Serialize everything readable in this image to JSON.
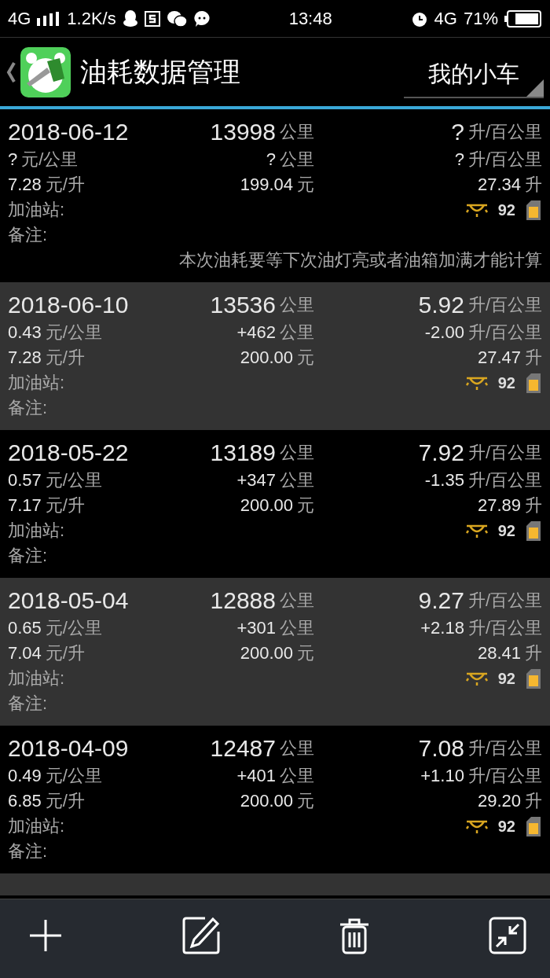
{
  "status_bar": {
    "network": "4G",
    "speed": "1.2K/s",
    "time": "13:48",
    "network_right": "4G",
    "battery": "71%"
  },
  "header": {
    "title": "油耗数据管理",
    "car_selector": "我的小车"
  },
  "records": [
    {
      "date": "2018-06-12",
      "odometer": "13998",
      "odometer_unit": "公里",
      "consumption": "?",
      "consumption_unit": "升/百公里",
      "cost_per_km": "?",
      "cost_per_km_unit": "元/公里",
      "distance": "?",
      "distance_unit": "公里",
      "delta": "?",
      "delta_unit": "升/百公里",
      "price": "7.28",
      "price_unit": "元/升",
      "amount": "199.04",
      "amount_unit": "元",
      "volume": "27.34",
      "volume_unit": "升",
      "station_label": "加油站:",
      "octane": "92",
      "note_label": "备注:",
      "message": "本次油耗要等下次油灯亮或者油箱加满才能计算"
    },
    {
      "date": "2018-06-10",
      "odometer": "13536",
      "odometer_unit": "公里",
      "consumption": "5.92",
      "consumption_unit": "升/百公里",
      "cost_per_km": "0.43",
      "cost_per_km_unit": "元/公里",
      "distance": "+462",
      "distance_unit": "公里",
      "delta": "-2.00",
      "delta_unit": "升/百公里",
      "price": "7.28",
      "price_unit": "元/升",
      "amount": "200.00",
      "amount_unit": "元",
      "volume": "27.47",
      "volume_unit": "升",
      "station_label": "加油站:",
      "octane": "92",
      "note_label": "备注:"
    },
    {
      "date": "2018-05-22",
      "odometer": "13189",
      "odometer_unit": "公里",
      "consumption": "7.92",
      "consumption_unit": "升/百公里",
      "cost_per_km": "0.57",
      "cost_per_km_unit": "元/公里",
      "distance": "+347",
      "distance_unit": "公里",
      "delta": "-1.35",
      "delta_unit": "升/百公里",
      "price": "7.17",
      "price_unit": "元/升",
      "amount": "200.00",
      "amount_unit": "元",
      "volume": "27.89",
      "volume_unit": "升",
      "station_label": "加油站:",
      "octane": "92",
      "note_label": "备注:"
    },
    {
      "date": "2018-05-04",
      "odometer": "12888",
      "odometer_unit": "公里",
      "consumption": "9.27",
      "consumption_unit": "升/百公里",
      "cost_per_km": "0.65",
      "cost_per_km_unit": "元/公里",
      "distance": "+301",
      "distance_unit": "公里",
      "delta": "+2.18",
      "delta_unit": "升/百公里",
      "price": "7.04",
      "price_unit": "元/升",
      "amount": "200.00",
      "amount_unit": "元",
      "volume": "28.41",
      "volume_unit": "升",
      "station_label": "加油站:",
      "octane": "92",
      "note_label": "备注:"
    },
    {
      "date": "2018-04-09",
      "odometer": "12487",
      "odometer_unit": "公里",
      "consumption": "7.08",
      "consumption_unit": "升/百公里",
      "cost_per_km": "0.49",
      "cost_per_km_unit": "元/公里",
      "distance": "+401",
      "distance_unit": "公里",
      "delta": "+1.10",
      "delta_unit": "升/百公里",
      "price": "6.85",
      "price_unit": "元/升",
      "amount": "200.00",
      "amount_unit": "元",
      "volume": "29.20",
      "volume_unit": "升",
      "station_label": "加油站:",
      "octane": "92",
      "note_label": "备注:"
    }
  ]
}
